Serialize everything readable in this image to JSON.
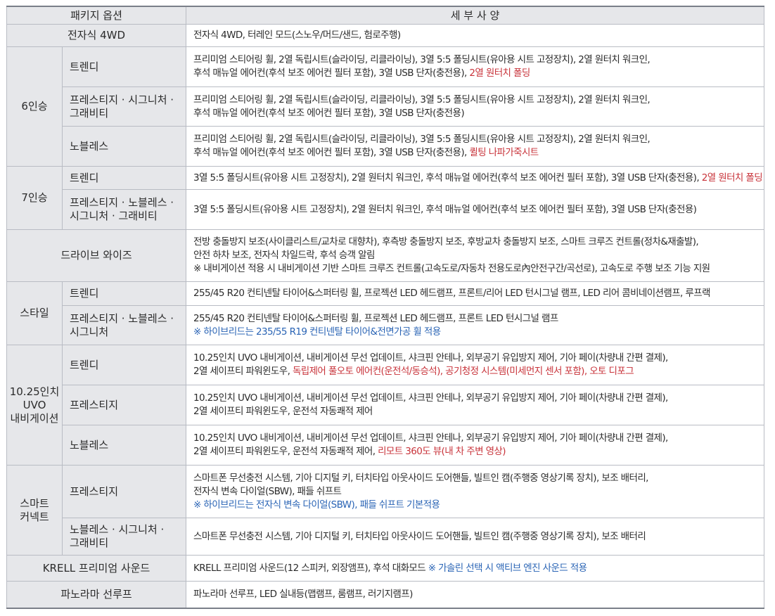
{
  "header": {
    "col1": "패키지 옵션",
    "col2": "세 부 사 양"
  },
  "rows": {
    "r4wd": {
      "group": "전자식 4WD",
      "detail": [
        "전자식 4WD, 터레인 모드(스노우/머드/샌드, 험로주행)"
      ]
    },
    "seat6": {
      "group": "6인승",
      "trendy": {
        "sub": "트렌디",
        "l1": "프리미엄 스티어링 휠, 2열 독립시트(슬라이딩, 리클라이닝), 3열 5:5 폴딩시트(유아용 시트 고정장치), 2열 원터치 워크인,",
        "l2": "후석 매뉴얼 에어컨(후석 보조 에어컨 필터 포함), 3열 USB 단자(충전용), ",
        "l2red": "2열 원터치 폴딩"
      },
      "prestige": {
        "sub1": "프레스티지 · 시그니처 ·",
        "sub2": "그래비티",
        "l1": "프리미엄 스티어링 휠, 2열 독립시트(슬라이딩, 리클라이닝), 3열 5:5 폴딩시트(유아용 시트 고정장치), 2열 원터치 워크인,",
        "l2": "후석 매뉴얼 에어컨(후석 보조 에어컨 필터 포함), 3열 USB 단자(충전용)"
      },
      "noblesse": {
        "sub": "노블레스",
        "l1": "프리미엄 스티어링 휠, 2열 독립시트(슬라이딩, 리클라이닝), 3열 5:5 폴딩시트(유아용 시트 고정장치), 2열 원터치 워크인,",
        "l2": "후석 매뉴얼 에어컨(후석 보조 에어컨 필터 포함), 3열 USB 단자(충전용), ",
        "l2red": "퀼팅 나파가죽시트"
      }
    },
    "seat7": {
      "group": "7인승",
      "trendy": {
        "sub": "트렌디",
        "l1": "3열 5:5 폴딩시트(유아용 시트 고정장치), 2열 원터치 워크인, 후석 매뉴얼 에어컨(후석 보조 에어컨 필터 포함), 3열 USB 단자(충전용), ",
        "l1red": "2열 원터치 폴딩"
      },
      "prestige": {
        "sub1": "프레스티지 · 노블레스 ·",
        "sub2": "시그니처 · 그래비티",
        "l1": "3열 5:5 폴딩시트(유아용 시트 고정장치), 2열 원터치 워크인, 후석 매뉴얼 에어컨(후석 보조 에어컨 필터 포함), 3열 USB 단자(충전용)"
      }
    },
    "drivewise": {
      "group": "드라이브 와이즈",
      "l1": "전방 충돌방지 보조(사이클리스트/교차로 대향차), 후측방 충돌방지 보조, 후방교차 충돌방지 보조, 스마트 크루즈 컨트롤(정차&재출발),",
      "l2": "안전 하차 보조, 전자식 차일드락, 후석 승객 알림",
      "l3": "※ 내비게이션 적용 시 내비게이션 기반 스마트 크루즈 컨트롤(고속도로/자동차 전용도로內안전구간/곡선로), 고속도로 주행 보조 기능 지원"
    },
    "style": {
      "group": "스타일",
      "trendy": {
        "sub": "트렌디",
        "l1": "255/45 R20 컨티넨탈 타이어&스퍼터링 휠, 프로젝션 LED 헤드램프, 프론트/리어 LED 턴시그널 램프, LED 리어 콤비네이션램프, 루프랙"
      },
      "prestige": {
        "sub1": "프레스티지 · 노블레스 ·",
        "sub2": "시그니처",
        "l1": "255/45 R20 컨티넨탈 타이어&스퍼터링 휠, 프로젝션 LED 헤드램프, 프론트 LED 턴시그널 램프",
        "l2blue": "※ 하이브리드는 235/55 R19 컨티넨탈 타이어&전면가공 휠 적용"
      }
    },
    "nav": {
      "group1": "10.25인치",
      "group2": "UVO",
      "group3": "내비게이션",
      "trendy": {
        "sub": "트렌디",
        "l1": "10.25인치 UVO 내비게이션, 내비게이션 무선 업데이트, 샤크핀 안테나, 외부공기 유입방지 제어, 기아 페이(차량내 간편 결제),",
        "l2": "2열 세이프티 파워윈도우, ",
        "l2red": "독립제어 풀오토 에어컨(운전석/동승석), 공기청정 시스템(미세먼지 센서 포함), 오토 디포그"
      },
      "prestige": {
        "sub": "프레스티지",
        "l1": "10.25인치 UVO 내비게이션, 내비게이션 무선 업데이트, 샤크핀 안테나, 외부공기 유입방지 제어, 기아 페이(차량내 간편 결제),",
        "l2": "2열 세이프티 파워윈도우, 운전석 자동쾌적 제어"
      },
      "noblesse": {
        "sub": "노블레스",
        "l1": "10.25인치 UVO 내비게이션, 내비게이션 무선 업데이트, 샤크핀 안테나, 외부공기 유입방지 제어, 기아 페이(차량내 간편 결제),",
        "l2": "2열 세이프티 파워윈도우, 운전석 자동쾌적 제어, ",
        "l2red": "리모트 360도 뷰(내 차 주변 영상)"
      }
    },
    "smart": {
      "group1": "스마트",
      "group2": "커넥트",
      "prestige": {
        "sub": "프레스티지",
        "l1": "스마트폰 무선충전 시스템, 기아 디지털 키, 터치타입 아웃사이드 도어핸들, 빌트인 캠(주행중 영상기록 장치), 보조 배터리,",
        "l2": "전자식 변속 다이얼(SBW), 패들 쉬프트",
        "l3blue": "※ 하이브리드는 전자식 변속 다이얼(SBW), 패들 쉬프트 기본적용"
      },
      "noblesse": {
        "sub1": "노블레스 · 시그니처 ·",
        "sub2": "그래비티",
        "l1": "스마트폰 무선충전 시스템, 기아 디지털 키, 터치타입 아웃사이드 도어핸들, 빌트인 캠(주행중 영상기록 장치), 보조 배터리"
      }
    },
    "krell": {
      "group": "KRELL 프리미엄 사운드",
      "l1": "KRELL 프리미엄 사운드(12 스피커, 외장앰프), 후석 대화모드 ",
      "l1blue": "※ 가솔린 선택 시 액티브 엔진 사운드 적용"
    },
    "sunroof": {
      "group": "파노라마 선루프",
      "l1": "파노라마 선루프, LED 실내등(맵램프, 룸램프, 러기지램프)"
    }
  },
  "colors": {
    "header_bg": "#e6e7ea",
    "border": "#b9bcc4",
    "highlight_red": "#c8333a",
    "note_blue": "#2a64b5"
  }
}
